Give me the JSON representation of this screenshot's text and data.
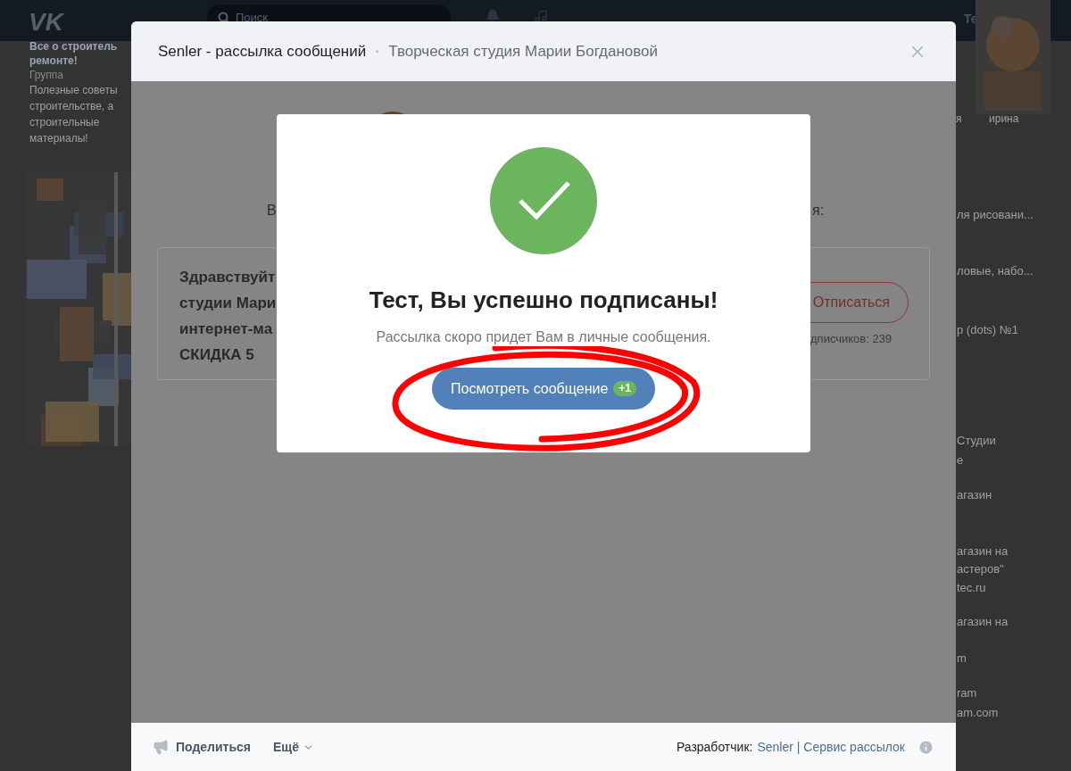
{
  "vk_header": {
    "logo": "VK",
    "search_placeholder": "Поиск",
    "user_name": "Те"
  },
  "left_sidebar": {
    "group_title_lines": [
      "Все о строитель",
      "ремонте!"
    ],
    "group_type": "Группа",
    "description_lines": [
      "Полезные советы",
      "строительстве, а",
      "строительные",
      "материалы!"
    ]
  },
  "right_sidebar": {
    "friend_labels": [
      "я",
      "ирина"
    ],
    "snippets": [
      "ля рисовани...",
      "ловые, набо...",
      "p (dots) №1",
      "Студии",
      "е",
      "агазин",
      "агазин на",
      "астеров\"",
      "tec.ru",
      "агазин на",
      "m",
      "ram",
      "am.com"
    ]
  },
  "app_modal": {
    "title": "Senler - рассылка сообщений",
    "subtitle": "Творческая студия Марии Богдановой",
    "intro_left": "В",
    "intro_right": "я:",
    "card": {
      "lines": [
        "Здравствуйт",
        "студии Мари",
        "интернет-ма",
        "СКИДКА 5"
      ],
      "unsubscribe": "Отписаться",
      "subscribers": "дписчиков: 239"
    },
    "footer": {
      "share": "Поделиться",
      "more": "Ещё",
      "developer_label": "Разработчик:",
      "developer_link": "Senler | Сервис рассылок"
    }
  },
  "success_dialog": {
    "title": "Тест, Вы успешно подписаны!",
    "text": "Рассылка скоро придет Вам в личные сообщения.",
    "button": "Посмотреть сообщение",
    "badge": "+1"
  }
}
